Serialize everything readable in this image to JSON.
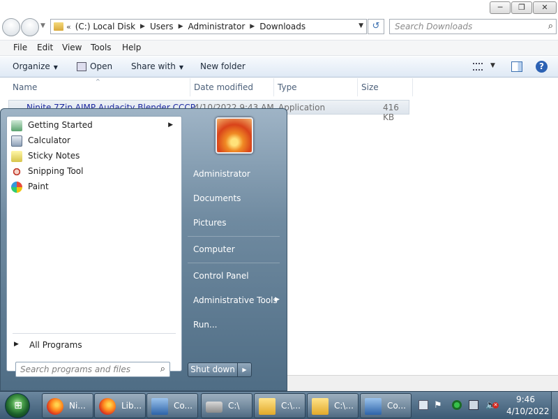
{
  "window": {
    "caption_buttons": {
      "minimize": "─",
      "maximize": "❐",
      "close": "✕"
    },
    "address": {
      "prefix": "«",
      "crumbs": [
        "(C:) Local Disk",
        "Users",
        "Administrator",
        "Downloads"
      ],
      "separator": "▶",
      "dropdown": "▼",
      "refresh": "↺"
    },
    "search": {
      "placeholder": "Search Downloads",
      "icon": "⌕"
    },
    "menu": [
      "File",
      "Edit",
      "View",
      "Tools",
      "Help"
    ],
    "toolbar": {
      "organize": "Organize",
      "open": "Open",
      "share_with": "Share with",
      "new_folder": "New folder",
      "help": "?",
      "caret": "▼"
    },
    "columns": [
      "Name",
      "Date modified",
      "Type",
      "Size"
    ],
    "sort_indicator": "^",
    "files": [
      {
        "name": "Ninite 7Zip AIMP Audacity Blender CCCP ...",
        "date": "4/10/2022 9:43 AM",
        "type": "Application",
        "size": "416 KB"
      }
    ]
  },
  "start_menu": {
    "programs": [
      {
        "label": "Getting Started",
        "icon": "getting-started-icon",
        "has_submenu": true
      },
      {
        "label": "Calculator",
        "icon": "calculator-icon"
      },
      {
        "label": "Sticky Notes",
        "icon": "sticky-notes-icon"
      },
      {
        "label": "Snipping Tool",
        "icon": "snipping-tool-icon"
      },
      {
        "label": "Paint",
        "icon": "paint-icon"
      }
    ],
    "submenu_arrow": "▶",
    "all_programs": "All Programs",
    "search_placeholder": "Search programs and files",
    "search_icon": "⌕",
    "right_items": [
      "Administrator",
      "Documents",
      "Pictures",
      "Computer",
      "Control Panel",
      "Administrative Tools",
      "Run..."
    ],
    "shutdown": "Shut down",
    "shutdown_arrow": "▶"
  },
  "taskbar": {
    "start_glyph": "⊞",
    "tasks": [
      {
        "label": "Ni...",
        "icon": "firefox-icon"
      },
      {
        "label": "Lib...",
        "icon": "firefox-icon"
      },
      {
        "label": "Co...",
        "icon": "computer-icon"
      },
      {
        "label": "C:\\",
        "icon": "drive-icon"
      },
      {
        "label": "C:\\...",
        "icon": "folder-icon"
      },
      {
        "label": "C:\\...",
        "icon": "folder-icon"
      },
      {
        "label": "Co...",
        "icon": "computer-icon"
      }
    ],
    "tray": {
      "flag": "⚑",
      "volume": "🔈",
      "volume_muted": "✕"
    },
    "clock": {
      "time": "9:46",
      "date": "4/10/2022"
    }
  }
}
